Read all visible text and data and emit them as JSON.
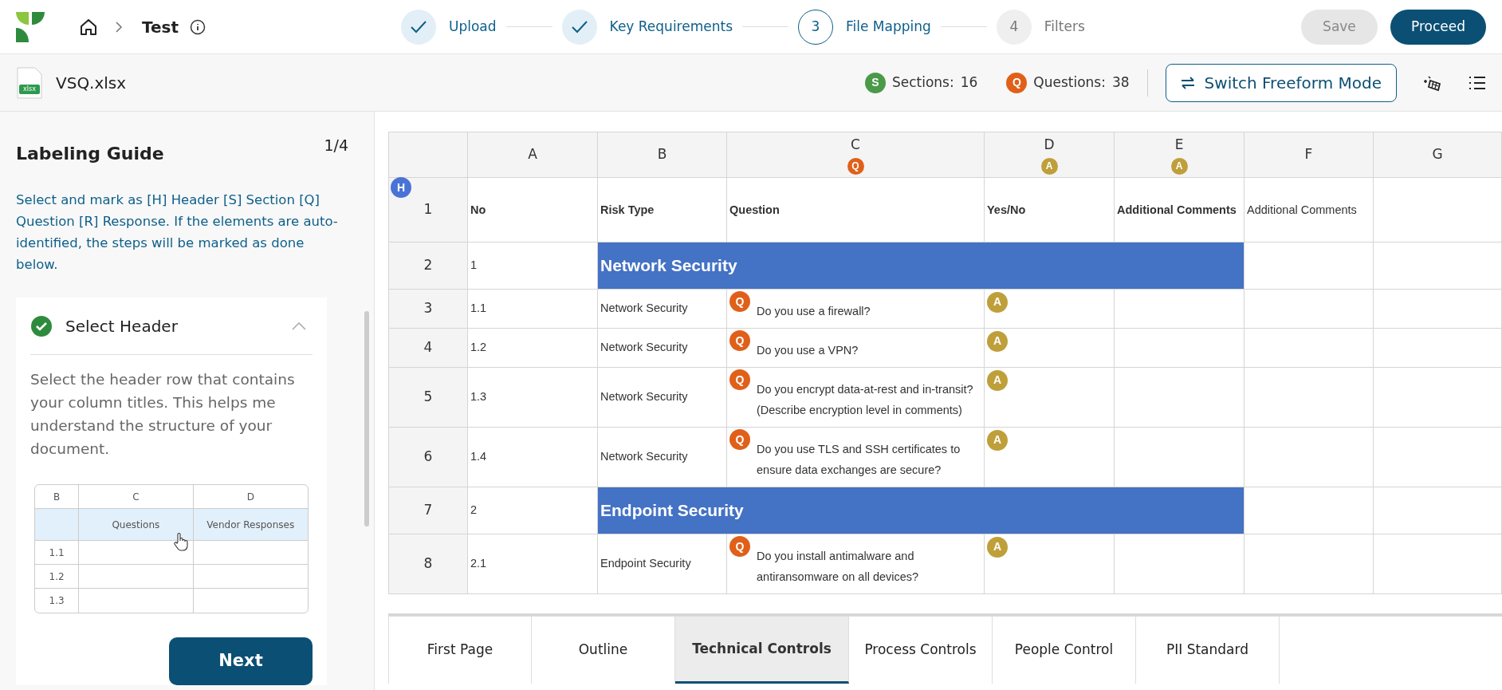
{
  "breadcrumb": {
    "title": "Test"
  },
  "steps": [
    {
      "label": "Upload",
      "done": true,
      "current": false
    },
    {
      "label": "Key Requirements",
      "done": true,
      "current": false
    },
    {
      "number": "3",
      "label": "File Mapping",
      "done": false,
      "current": true
    },
    {
      "number": "4",
      "label": "Filters",
      "done": false,
      "current": false
    }
  ],
  "actions": [
    {
      "label": "Save",
      "disabled": true
    },
    {
      "label": "Proceed",
      "disabled": false
    }
  ],
  "file": {
    "name": "VSQ.xlsx",
    "type_label": "xlsx"
  },
  "stats": [
    {
      "badge": "S",
      "kind": "section",
      "label": "Sections:",
      "value": "16"
    },
    {
      "badge": "Q",
      "kind": "question",
      "label": "Questions:",
      "value": "38"
    }
  ],
  "mode_button": {
    "label": "Switch Freeform Mode"
  },
  "guide": {
    "title": "Labeling Guide",
    "page": "1/4",
    "intro": "Select and mark as [H] Header [S] Section [Q] Question [R] Response. If the elements are auto-identified, the steps will be marked as done below.",
    "step": {
      "title": "Select Header",
      "done": true,
      "expanded": true,
      "description": "Select the header row that contains your column titles. This helps me understand the structure of your document.",
      "example": {
        "columns": [
          "B",
          "C",
          "D"
        ],
        "header_cells": [
          "",
          "Questions",
          "Vendor Responses"
        ],
        "rows": [
          "1.1",
          "1.2",
          "1.3"
        ]
      }
    },
    "next_button": "Next"
  },
  "sheet": {
    "columns": [
      {
        "letter": "A"
      },
      {
        "letter": "B"
      },
      {
        "letter": "C",
        "badge": "Q",
        "kind": "question"
      },
      {
        "letter": "D",
        "badge": "A",
        "kind": "answer"
      },
      {
        "letter": "E",
        "badge": "A",
        "kind": "answer"
      },
      {
        "letter": "F"
      },
      {
        "letter": "G"
      }
    ],
    "rows": [
      {
        "kind": "header",
        "number": "1",
        "badge": "H",
        "cells": [
          {
            "text": "No",
            "bold": true
          },
          {
            "text": "Risk Type",
            "bold": true
          },
          {
            "text": "Question",
            "bold": true
          },
          {
            "text": "Yes/No",
            "bold": true
          },
          {
            "text": "Additional Comments",
            "bold": true
          },
          {
            "text": "Additional Comments",
            "bold": false
          }
        ]
      },
      {
        "kind": "section",
        "number": "2",
        "no": "1",
        "title": "Network Security"
      },
      {
        "kind": "question",
        "number": "3",
        "no": "1.1",
        "risk": "Network Security",
        "q_badge": "Q",
        "question": "Do you use a firewall?",
        "a_badge": "A"
      },
      {
        "kind": "question",
        "number": "4",
        "no": "1.2",
        "risk": "Network Security",
        "q_badge": "Q",
        "question": "Do you use a VPN?",
        "a_badge": "A"
      },
      {
        "kind": "question",
        "number": "5",
        "no": "1.3",
        "risk": "Network Security",
        "q_badge": "Q",
        "question": "Do you encrypt data-at-rest and in-transit? (Describe encryption level in comments)",
        "a_badge": "A"
      },
      {
        "kind": "question",
        "number": "6",
        "no": "1.4",
        "risk": "Network Security",
        "q_badge": "Q",
        "question": "Do you use TLS and SSH certificates to ensure data exchanges are secure?",
        "a_badge": "A"
      },
      {
        "kind": "section",
        "number": "7",
        "no": "2",
        "title": "Endpoint Security"
      },
      {
        "kind": "question",
        "number": "8",
        "no": "2.1",
        "risk": "Endpoint Security",
        "q_badge": "Q",
        "question": "Do you install antimalware and antiransomware on all devices?",
        "a_badge": "A"
      }
    ]
  },
  "tabs": [
    {
      "label": "First Page",
      "selected": false
    },
    {
      "label": "Outline",
      "selected": false
    },
    {
      "label": "Technical Controls",
      "selected": true
    },
    {
      "label": "Process Controls",
      "selected": false
    },
    {
      "label": "People Control",
      "selected": false
    },
    {
      "label": "PII Standard",
      "selected": false
    }
  ]
}
